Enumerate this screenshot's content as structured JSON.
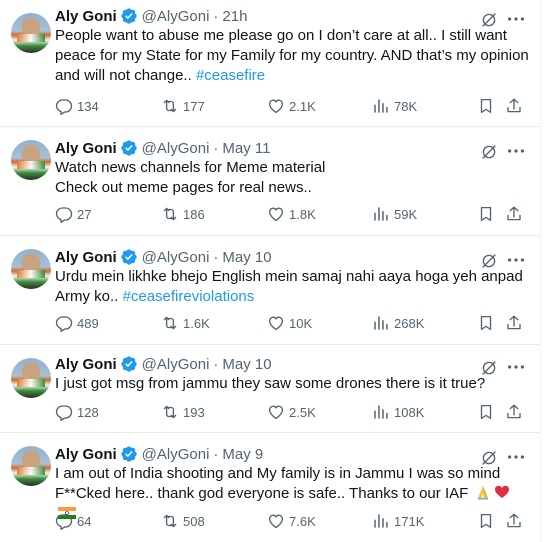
{
  "colors": {
    "accent": "#1d9bf0",
    "muted": "#536471",
    "text": "#0f1419"
  },
  "tweets": [
    {
      "name": "Aly Goni",
      "handle": "@AlyGoni",
      "dot": "·",
      "time": "21h",
      "text": "People want to abuse me please go on I don’t care at all.. I still want peace for my State for my Family for my country. AND that’s my opinion and will not change.. ",
      "hashtag": "#ceasefire",
      "replies": "134",
      "retweets": "177",
      "likes": "2.1K",
      "views": "78K"
    },
    {
      "name": "Aly Goni",
      "handle": "@AlyGoni",
      "dot": "·",
      "time": "May 11",
      "line1": "Watch news channels for Meme material",
      "line2": "Check out meme pages for real news..",
      "replies": "27",
      "retweets": "186",
      "likes": "1.8K",
      "views": "59K"
    },
    {
      "name": "Aly Goni",
      "handle": "@AlyGoni",
      "dot": "·",
      "time": "May 10",
      "text": "Urdu mein likhke bhejo English mein samaj nahi aaya hoga yeh anpad Army ko.. ",
      "hashtag": "#ceasefireviolations",
      "replies": "489",
      "retweets": "1.6K",
      "likes": "10K",
      "views": "268K"
    },
    {
      "name": "Aly Goni",
      "handle": "@AlyGoni",
      "dot": "·",
      "time": "May 10",
      "text": "I just got msg from jammu they saw some drones there is it true?",
      "replies": "128",
      "retweets": "193",
      "likes": "2.5K",
      "views": "108K"
    },
    {
      "name": "Aly Goni",
      "handle": "@AlyGoni",
      "dot": "·",
      "time": "May 9",
      "text": "I am out of India shooting and My family is in Jammu I was so mind F**Cked here.. thank god everyone is safe.. Thanks to our IAF",
      "emojis": [
        "folded-hands",
        "red-heart",
        "india-flag"
      ],
      "replies": "64",
      "retweets": "508",
      "likes": "7.6K",
      "views": "171K"
    }
  ]
}
